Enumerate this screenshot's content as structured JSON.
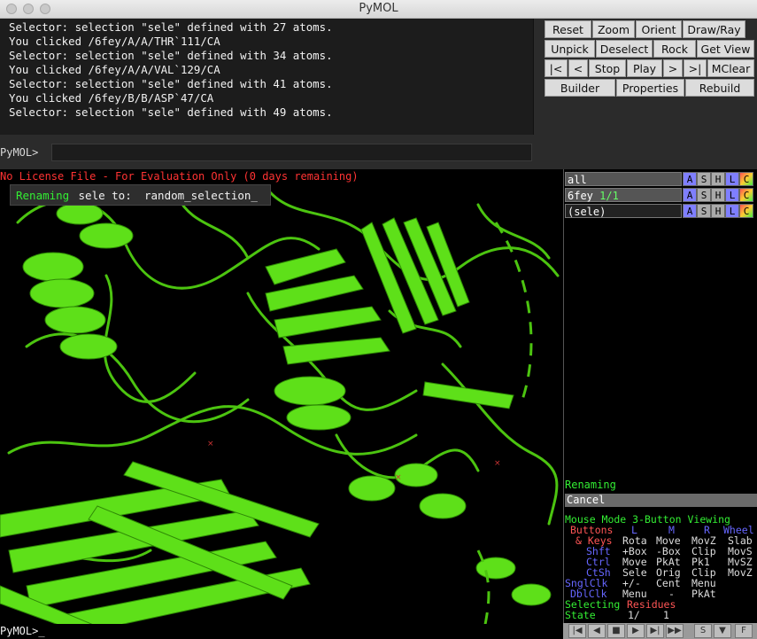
{
  "window": {
    "title": "PyMOL"
  },
  "log": {
    "lines": [
      "Selector: selection \"sele\" defined with 27 atoms.",
      "You clicked /6fey/A/A/THR`111/CA",
      "Selector: selection \"sele\" defined with 34 atoms.",
      "You clicked /6fey/A/A/VAL`129/CA",
      "Selector: selection \"sele\" defined with 41 atoms.",
      "You clicked /6fey/B/B/ASP`47/CA",
      "Selector: selection \"sele\" defined with 49 atoms."
    ]
  },
  "command": {
    "prompt": "PyMOL>",
    "value": ""
  },
  "buttons": {
    "row1": [
      "Reset",
      "Zoom",
      "Orient",
      "Draw/Ray"
    ],
    "row2": [
      "Unpick",
      "Deselect",
      "Rock",
      "Get View"
    ],
    "row3": [
      "|<",
      "<",
      "Stop",
      "Play",
      ">",
      ">|",
      "MClear"
    ],
    "row4": [
      "Builder",
      "Properties",
      "Rebuild"
    ]
  },
  "viewport": {
    "watermark": "No License File - For Evaluation Only (0 days remaining)",
    "rename_label": "Renaming",
    "rename_middle": " sele to: ",
    "rename_value": "random_selection_",
    "bottom_prompt": "PyMOL>_"
  },
  "objects": [
    {
      "name": "all",
      "state": ""
    },
    {
      "name": "6fey",
      "state": "1/1"
    },
    {
      "name": "(sele)",
      "state": ""
    }
  ],
  "object_buttons": [
    "A",
    "S",
    "H",
    "L",
    "C"
  ],
  "wizard": {
    "title": "Renaming",
    "cancel": "Cancel"
  },
  "mouse_mode": {
    "header": "Mouse Mode 3-Button Viewing",
    "buttons_label": "Buttons",
    "buttons_cols": [
      "L",
      "M",
      "R",
      "Wheel"
    ],
    "keys_label": "& Keys",
    "rows": [
      {
        "key": "",
        "vals": [
          "Rota",
          "Move",
          "MovZ",
          "Slab"
        ]
      },
      {
        "key": "Shft",
        "vals": [
          "+Box",
          "-Box",
          "Clip",
          "MovS"
        ]
      },
      {
        "key": "Ctrl",
        "vals": [
          "Move",
          "PkAt",
          "Pk1",
          "MvSZ"
        ]
      },
      {
        "key": "CtSh",
        "vals": [
          "Sele",
          "Orig",
          "Clip",
          "MovZ"
        ]
      }
    ],
    "sngl_label": "SnglClk",
    "sngl_vals": [
      "+/-",
      "Cent",
      "Menu"
    ],
    "dbl_label": "DblClk",
    "dbl_vals": [
      "Menu",
      "-",
      "PkAt"
    ],
    "selecting_label": "Selecting",
    "selecting_value": "Residues",
    "state_label": "State",
    "state_value": "1/",
    "state_total": "1"
  },
  "vcr": [
    "|◀",
    "◀",
    "■",
    "▶",
    "▶|",
    "▶▶",
    "S",
    "▼",
    "F"
  ],
  "colors": {
    "protein": "#55dd11",
    "accent_green": "#33ee33",
    "warning_red": "#ff3333"
  }
}
